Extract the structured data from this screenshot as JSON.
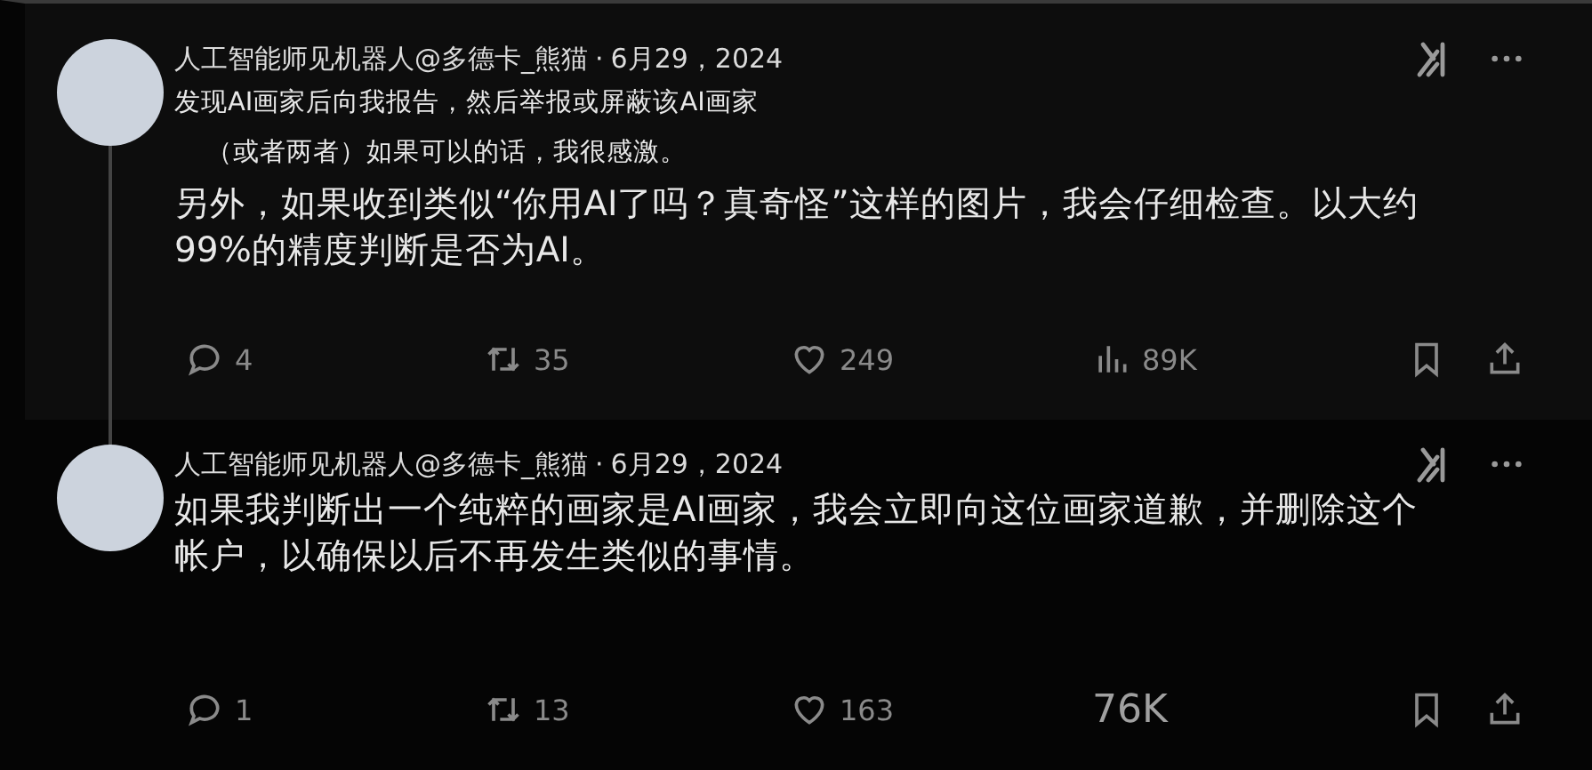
{
  "posts": [
    {
      "author": "人工智能师见机器人@多德卡_熊猫",
      "separator": "·",
      "date": "6月29，2024",
      "thread_line": true,
      "body": [
        {
          "kind": "small",
          "text": "发现AI画家后向我报告，然后举报或屏蔽该AI画家"
        },
        {
          "kind": "small",
          "text": "（或者两者）如果可以的话，我很感激。"
        },
        {
          "kind": "large",
          "text": "另外，如果收到类似“你用AI了吗？真奇怪”这样的图片，我会仔细检查。以大约99%的精度判断是否为AI。"
        }
      ],
      "stats": [
        {
          "kind": "reply",
          "count": "4"
        },
        {
          "kind": "repost",
          "count": "35"
        },
        {
          "kind": "like",
          "count": "249"
        },
        {
          "kind": "views",
          "count": "89K"
        }
      ]
    },
    {
      "author": "人工智能师见机器人@多德卡_熊猫",
      "separator": "·",
      "date": "6月29，2024",
      "body": [
        {
          "kind": "large",
          "text": "如果我判断出一个纯粹的画家是AI画家，我会立即向这位画家道歉，并删除这个帐户，以确保以后不再发生类似的事情。"
        }
      ],
      "stats": [
        {
          "kind": "reply",
          "count": "1"
        },
        {
          "kind": "repost",
          "count": "13"
        },
        {
          "kind": "like",
          "count": "163"
        },
        {
          "kind": "plain",
          "count": "76K"
        }
      ]
    }
  ]
}
